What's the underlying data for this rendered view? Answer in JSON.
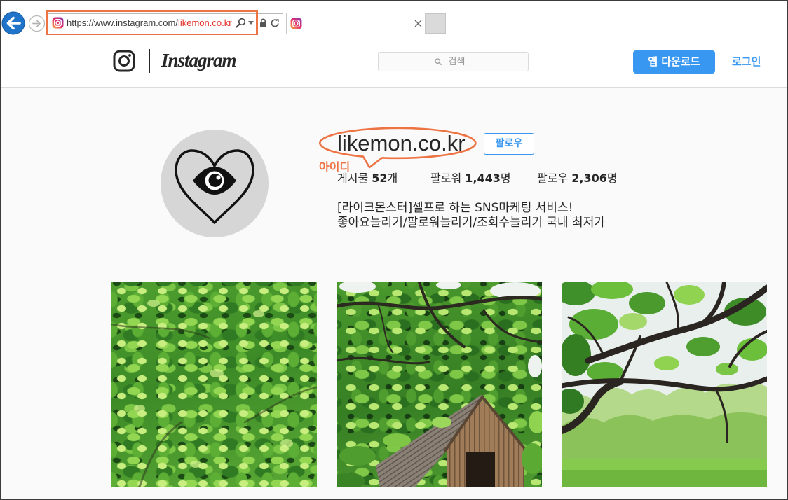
{
  "browser": {
    "url_base": "https://www.instagram.com/",
    "url_path": "likemon.co.kr",
    "icons": {
      "back": "back-arrow-icon",
      "forward": "forward-arrow-icon",
      "favicon": "instagram-favicon-icon",
      "address_search": "search-icon",
      "address_dropdown": "chevron-down-icon",
      "secure": "lock-icon",
      "refresh": "refresh-icon",
      "tab_close": "close-icon",
      "new_tab": "new-tab-icon"
    }
  },
  "header": {
    "logo_text": "Instagram",
    "logo_icon": "instagram-glyph-icon",
    "search_placeholder": "검색",
    "search_icon": "search-icon",
    "app_download_label": "앱 다운로드",
    "login_label": "로그인"
  },
  "profile": {
    "username": "likemon.co.kr",
    "avatar_icon": "heart-eye-logo-icon",
    "follow_label": "팔로우",
    "stats": [
      {
        "label": "게시물",
        "value": "52",
        "unit": "개"
      },
      {
        "label": "팔로워",
        "value": "1,443",
        "unit": "명"
      },
      {
        "label": "팔로우",
        "value": "2,306",
        "unit": "명"
      }
    ],
    "bio": [
      "[라이크몬스터]셀프로 하는 SNS마케팅 서비스!",
      "좋아요늘리기/팔로워늘리기/조회수늘리기 국내 최저가"
    ]
  },
  "annotation": {
    "label": "아이디"
  },
  "colors": {
    "accent": "#3897f0",
    "annotation": "#ee7343",
    "url_highlight": "#e4322b",
    "back_button": "#1f74c9"
  }
}
